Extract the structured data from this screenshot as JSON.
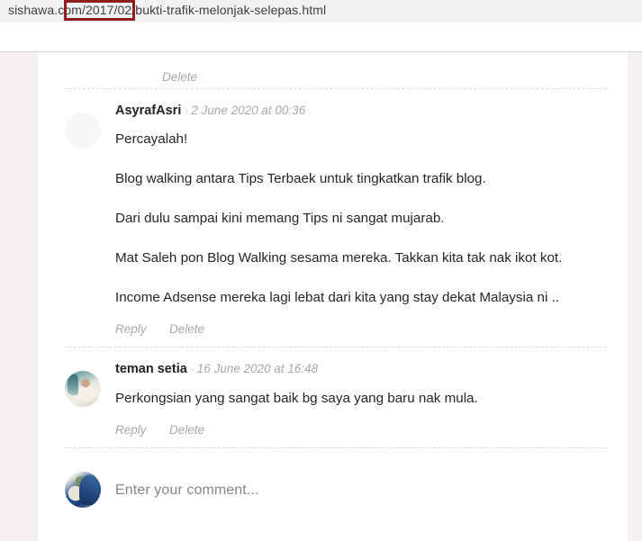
{
  "browser": {
    "url": "sishawa.com/2017/02/bukti-trafik-melonjak-selepas.html",
    "highlight_color": "#8f1d1d"
  },
  "comments_section": {
    "top_action_label": "Delete",
    "comments": [
      {
        "author": "AsyrafAsri",
        "separator": "·",
        "timestamp": "2 June 2020 at 00:36",
        "avatar": "blank-avatar",
        "paragraphs": [
          "Percayalah!",
          "Blog walking antara Tips Terbaek untuk tingkatkan trafik blog.",
          "Dari dulu sampai kini memang Tips ni sangat mujarab.",
          "Mat Saleh pon Blog Walking sesama mereka. Takkan kita tak nak ikot kot.",
          "Income Adsense mereka lagi lebat dari kita yang stay dekat Malaysia ni .."
        ],
        "reply_label": "Reply",
        "delete_label": "Delete"
      },
      {
        "author": "teman setia",
        "separator": "·",
        "timestamp": "16 June 2020 at 16:48",
        "avatar": "photo-avatar-teman-setia",
        "paragraphs": [
          "Perkongsian yang sangat baik bg saya yang baru nak mula."
        ],
        "reply_label": "Reply",
        "delete_label": "Delete"
      }
    ],
    "comment_form": {
      "avatar": "photo-avatar-current-user",
      "placeholder": "Enter your comment..."
    }
  }
}
